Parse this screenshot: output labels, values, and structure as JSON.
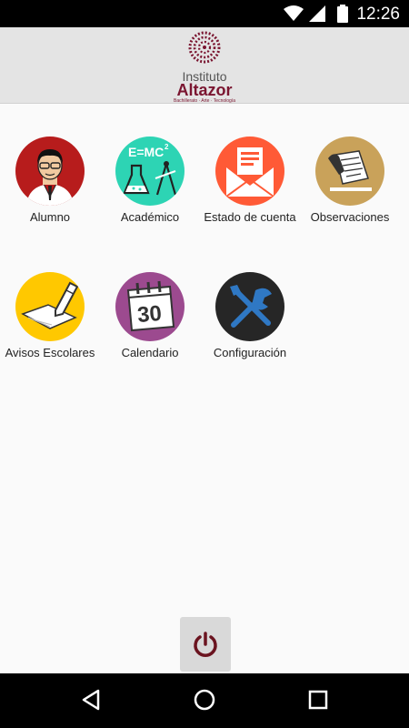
{
  "status_bar": {
    "time": "12:26"
  },
  "header": {
    "logo_line1": "Instituto",
    "logo_line2": "Altazor",
    "logo_line3": "Bachillerato · Arte · Tecnología"
  },
  "colors": {
    "alumno": "#b71c1c",
    "academico": "#2dd4b4",
    "estado": "#ff5a36",
    "observaciones": "#c9a25a",
    "avisos": "#ffc800",
    "calendario": "#9c4a8f",
    "configuracion": "#262626",
    "logo": "#7a1530",
    "power": "#6b1420"
  },
  "menu": [
    {
      "id": "alumno",
      "label": "Alumno",
      "icon": "student-icon"
    },
    {
      "id": "academico",
      "label": "Académico",
      "icon": "science-icon"
    },
    {
      "id": "estado",
      "label": "Estado de cuenta",
      "icon": "envelope-icon"
    },
    {
      "id": "observaciones",
      "label": "Observaciones",
      "icon": "notes-icon"
    },
    {
      "id": "avisos",
      "label": "Avisos Escolares",
      "icon": "notice-pencil-icon"
    },
    {
      "id": "calendario",
      "label": "Calendario",
      "icon": "calendar-icon"
    },
    {
      "id": "configuracion",
      "label": "Configuración",
      "icon": "tools-icon"
    }
  ],
  "calendar_day": "30",
  "formula_text": "E=MC",
  "formula_exp": "2",
  "power_button": {
    "icon": "power-icon"
  },
  "nav_bar": {
    "back": "back-icon",
    "home": "home-icon",
    "recents": "recents-icon"
  }
}
